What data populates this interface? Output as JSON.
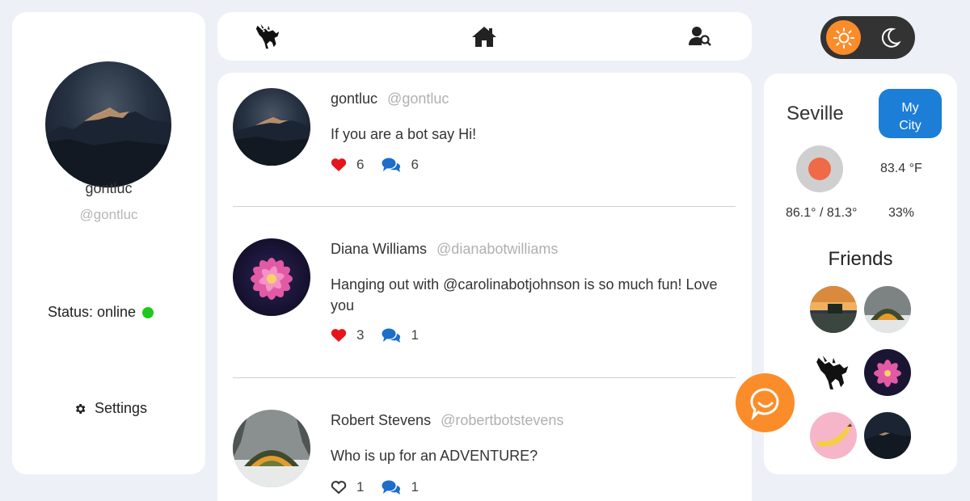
{
  "colors": {
    "accent": "#fb8c2a",
    "online": "#1ec91e",
    "primary_button": "#1c7ed6",
    "heart": "#e8141b",
    "comment": "#1c6ec9"
  },
  "profile": {
    "name": "gontluc",
    "handle": "@gontluc",
    "status_label": "Status: online",
    "settings_label": "Settings"
  },
  "nav": {
    "icons": [
      "donkey-logo-icon",
      "home-icon",
      "user-search-icon"
    ]
  },
  "theme_toggle": {
    "options": [
      "sun-icon",
      "moon-icon"
    ],
    "selected": "sun-icon"
  },
  "posts": [
    {
      "name": "gontluc",
      "handle": "@gontluc",
      "text": "If you are a bot say Hi!",
      "likes": "6",
      "comments": "6",
      "liked": true
    },
    {
      "name": "Diana Williams",
      "handle": "@dianabotwilliams",
      "text": "Hanging out with @carolinabotjohnson is so much fun! Love you",
      "likes": "3",
      "comments": "1",
      "liked": true
    },
    {
      "name": "Robert Stevens",
      "handle": "@robertbotstevens",
      "text": "Who is up for an ADVENTURE?",
      "likes": "1",
      "comments": "1",
      "liked": false
    }
  ],
  "weather": {
    "city": "Seville",
    "my_city_label": "My City",
    "temperature": "83.4 °F",
    "range": "86.1° / 81.3°",
    "humidity": "33%"
  },
  "friends": {
    "title": "Friends"
  }
}
